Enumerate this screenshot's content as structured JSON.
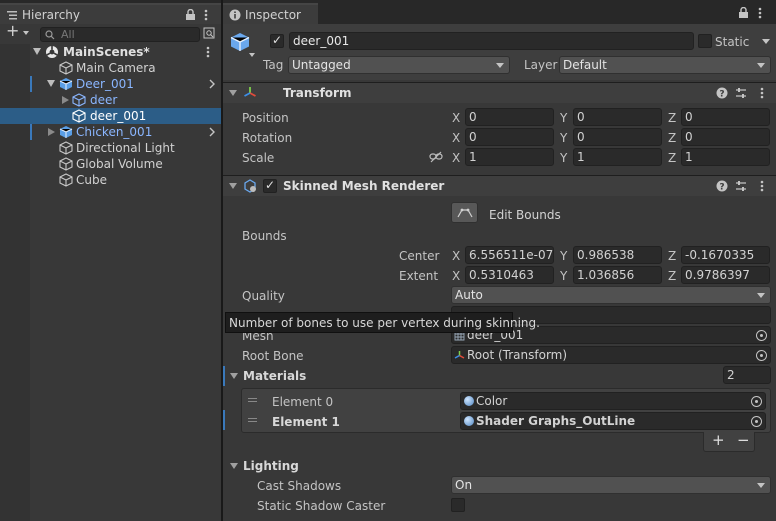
{
  "hierarchy": {
    "tab_label": "Hierarchy",
    "search_placeholder": "All",
    "add_label": "+",
    "scene_name": "MainScenes*",
    "items": [
      {
        "label": "Main Camera"
      },
      {
        "label": "Deer_001"
      },
      {
        "label": "deer"
      },
      {
        "label": "deer_001"
      },
      {
        "label": "Chicken_001"
      },
      {
        "label": "Directional Light"
      },
      {
        "label": "Global Volume"
      },
      {
        "label": "Cube"
      }
    ]
  },
  "inspector": {
    "tab_label": "Inspector",
    "object_name": "deer_001",
    "static_label": "Static",
    "tag_label": "Tag",
    "tag_value": "Untagged",
    "layer_label": "Layer",
    "layer_value": "Default",
    "transform": {
      "title": "Transform",
      "position_label": "Position",
      "rotation_label": "Rotation",
      "scale_label": "Scale",
      "x_label": "X",
      "y_label": "Y",
      "z_label": "Z",
      "position": [
        "0",
        "0",
        "0"
      ],
      "rotation": [
        "0",
        "0",
        "0"
      ],
      "scale": [
        "1",
        "1",
        "1"
      ]
    },
    "smr": {
      "title": "Skinned Mesh Renderer",
      "edit_bounds": "Edit Bounds",
      "bounds_label": "Bounds",
      "center_label": "Center",
      "extent_label": "Extent",
      "center": [
        "6.556511e-07",
        "0.986538",
        "-0.1670335"
      ],
      "extent": [
        "0.5310463",
        "1.036856",
        "0.9786397"
      ],
      "quality_label": "Quality",
      "quality_value": "Auto",
      "tooltip": "Number of bones to use per vertex during skinning.",
      "mesh_label": "Mesh",
      "mesh_value": "deer_001",
      "root_bone_label": "Root Bone",
      "root_bone_value": "Root (Transform)",
      "materials_label": "Materials",
      "materials_count": "2",
      "elements": [
        {
          "label": "Element 0",
          "value": "Color"
        },
        {
          "label": "Element 1",
          "value": "Shader Graphs_OutLine"
        }
      ],
      "add_label": "+",
      "remove_label": "−"
    },
    "lighting": {
      "title": "Lighting",
      "cast_shadows_label": "Cast Shadows",
      "cast_shadows_value": "On",
      "static_shadow_label": "Static Shadow Caster"
    }
  }
}
